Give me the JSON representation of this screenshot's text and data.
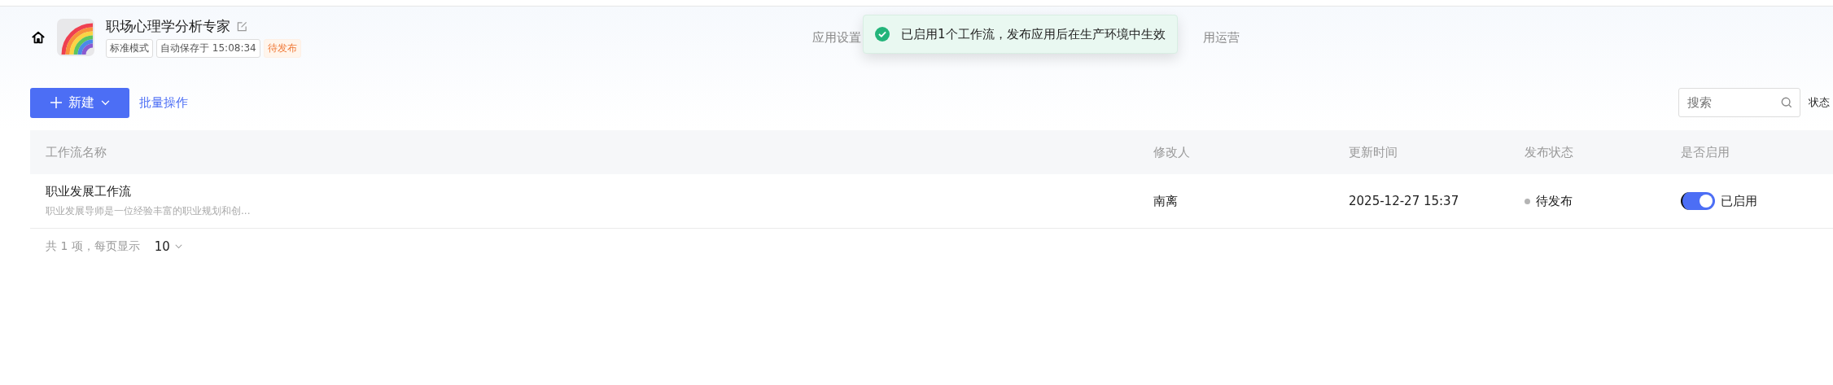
{
  "app": {
    "name": "职场心理学分析专家",
    "tags": [
      {
        "kind": "plain",
        "text": "标准模式"
      },
      {
        "kind": "plain",
        "text": "自动保存于 15:08:34"
      },
      {
        "kind": "warning",
        "text": "待发布"
      }
    ]
  },
  "nav": [
    {
      "label": "应用设置"
    },
    {
      "label": "用运营"
    }
  ],
  "toast": {
    "kind": "success",
    "text": "已启用1个工作流，发布应用后在生产环境中生效"
  },
  "toolbar": {
    "new_button": "新建",
    "batch_link": "批量操作",
    "search": {
      "placeholder": "搜索"
    },
    "filter_label": "状态"
  },
  "table": {
    "columns": [
      "工作流名称",
      "修改人",
      "更新时间",
      "发布状态",
      "是否启用"
    ],
    "rows": [
      {
        "name": "职业发展工作流",
        "description": "职业发展导师是一位经验丰富的职业规划和创...",
        "modifier": "南离",
        "updated": "2025-12-27 15:37",
        "status": "待发布",
        "enabled": true,
        "enabled_label": "已启用"
      }
    ]
  },
  "pagination": {
    "total": "共 1 项，每页显示",
    "page_size": "10"
  }
}
